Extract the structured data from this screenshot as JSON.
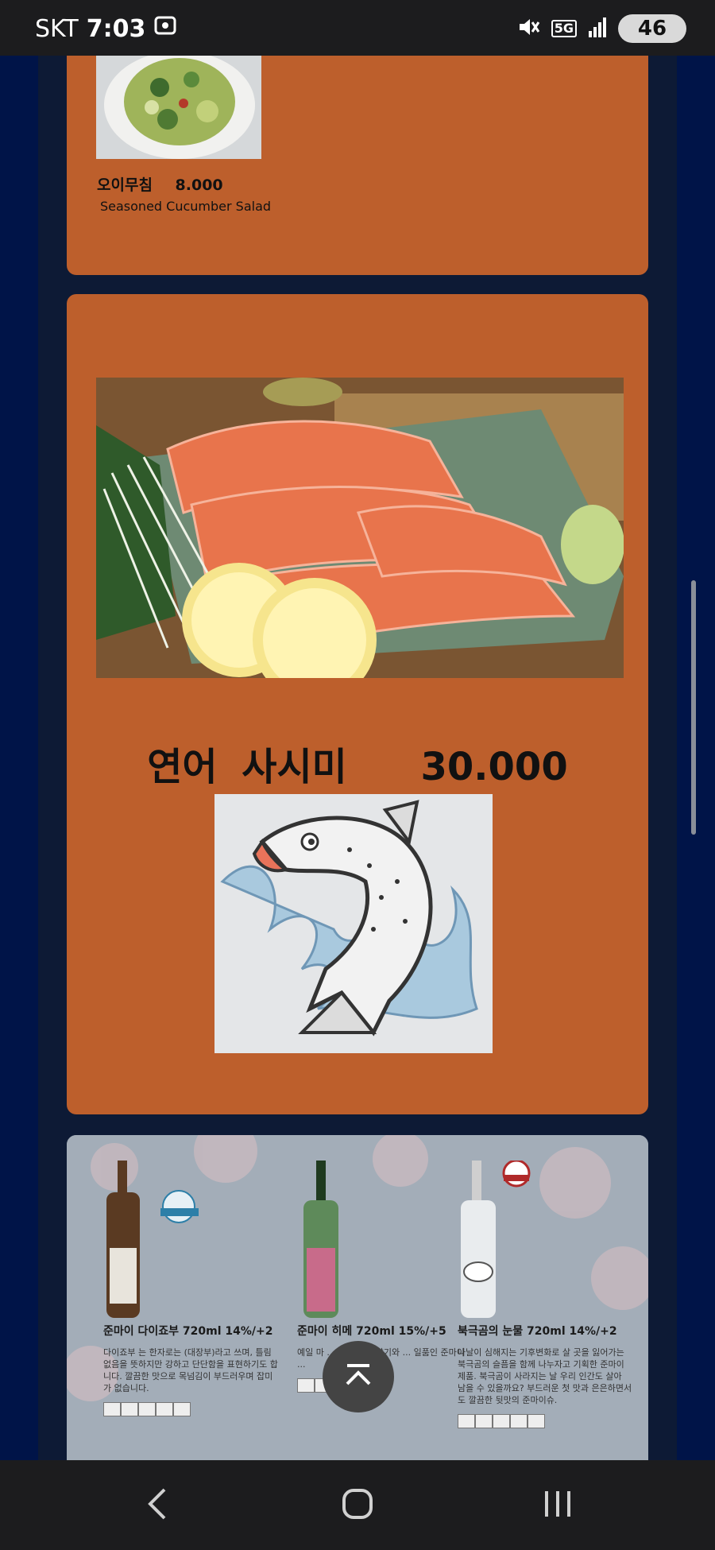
{
  "status_bar": {
    "carrier": "SKT",
    "time": "7:03",
    "network": "5G",
    "battery": "46"
  },
  "menu": {
    "cucumber": {
      "name_ko": "오이무침",
      "price": "8.000",
      "name_en": "Seasoned Cucumber Salad"
    },
    "salmon": {
      "name_ko": "연어 사시미",
      "price": "30.000"
    },
    "sake": [
      {
        "name": "준마이 다이죠부 720ml 14%/+2",
        "badge": "생주 나마자케",
        "desc": "다이죠부 는 한자로는 (대장부)라고 쓰며, 틀림없음을 뜻하지만 강하고 단단함을 표현하기도 합니다. 깔끔한 맛으로 목넘김이 부드러우며 잡미가 없습니다."
      },
      {
        "name": "준마이 히메 720ml 15%/+5",
        "badge": "",
        "desc": "예일 마 ... 며 온화한 향기와 ... 일품인 준마이 ..."
      },
      {
        "name": "북극곰의 눈물 720ml 14%/+2",
        "badge": "BEST 베스트셀러",
        "desc": "나날이 심해지는 기후변화로 살 곳을 잃어가는 북극곰의 슬픔을 함께 나누자고 기획한 준마이 제품. 북극곰이 사라지는 날 우리 인간도 살아 남을 수 있을까요? 부드러운 첫 맛과 은은하면서도 깔끔한 뒷맛의 준마이슈."
      }
    ]
  },
  "colors": {
    "card_orange": "#bd5f2c",
    "page_bg": "#0d1a35",
    "side_blue": "#001448"
  },
  "icons": {
    "screenshot": "screenshot-icon",
    "mute": "mute-icon",
    "signal": "signal-icon",
    "back": "back-icon",
    "home": "home-icon",
    "recents": "recents-icon",
    "scroll_top": "scroll-top-icon"
  }
}
